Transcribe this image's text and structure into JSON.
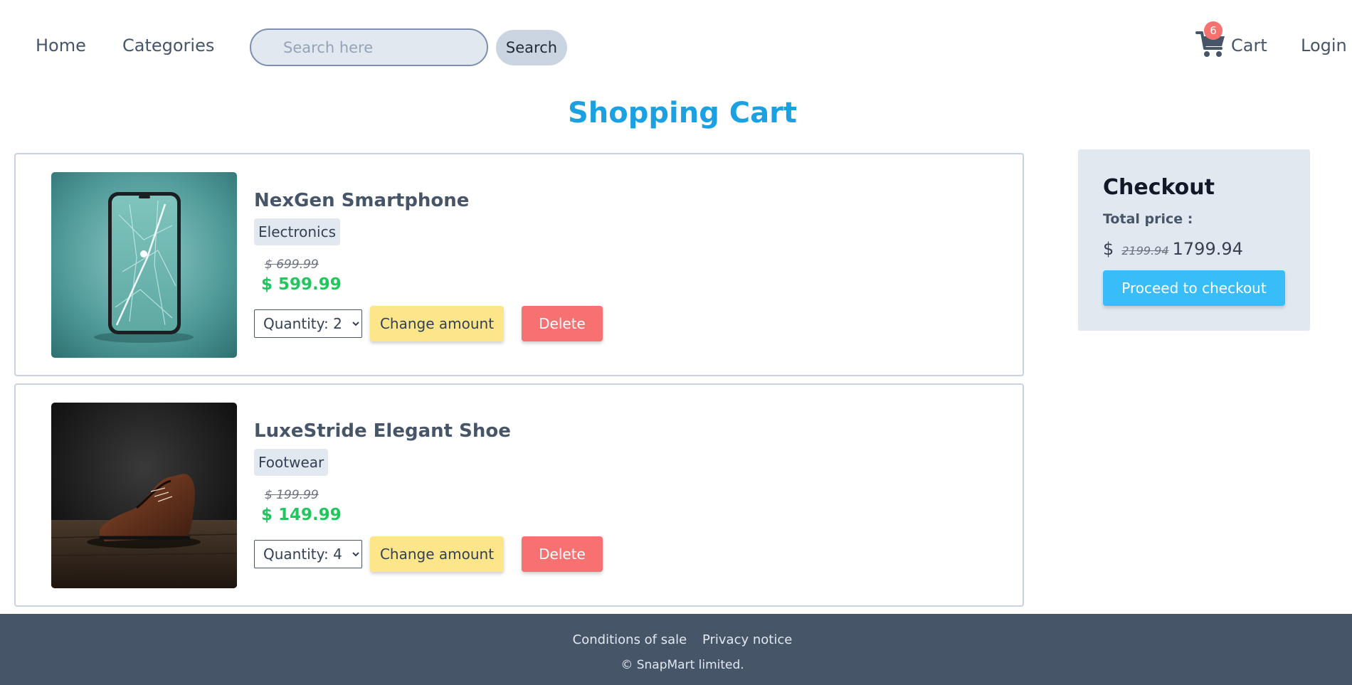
{
  "nav": {
    "home_label": "Home",
    "categories_label": "Categories",
    "search_placeholder": "Search here",
    "search_value": "",
    "search_button_label": "Search",
    "cart_icon": "shopping-cart-icon",
    "cart_count": "6",
    "cart_label": "Cart",
    "login_label": "Login"
  },
  "page": {
    "title": "Shopping Cart"
  },
  "cart": {
    "items": [
      {
        "name": "NexGen Smartphone",
        "category": "Electronics",
        "old_price": "$ 699.99",
        "new_price": "$ 599.99",
        "quantity_label": "Quantity: 2",
        "change_amount_label": "Change amount",
        "delete_label": "Delete",
        "image": "smartphone-photo"
      },
      {
        "name": "LuxeStride Elegant Shoe",
        "category": "Footwear",
        "old_price": "$ 199.99",
        "new_price": "$ 149.99",
        "quantity_label": "Quantity: 4",
        "change_amount_label": "Change amount",
        "delete_label": "Delete",
        "image": "leather-shoe-photo"
      }
    ]
  },
  "checkout": {
    "title": "Checkout",
    "total_label": "Total price :",
    "currency": "$",
    "old_total": "2199.94",
    "new_total": "1799.94",
    "button_label": "Proceed to checkout"
  },
  "footer": {
    "conditions_label": "Conditions of sale",
    "privacy_label": "Privacy notice",
    "copyright": "© SnapMart limited."
  },
  "colors": {
    "title": "#1ba1e2",
    "price_green": "#22c55e",
    "change_button": "#fde68a",
    "delete_button": "#f87171",
    "checkout_button": "#38bdf8",
    "footer_bg": "#475569",
    "panel_bg": "#e2e8f0"
  }
}
